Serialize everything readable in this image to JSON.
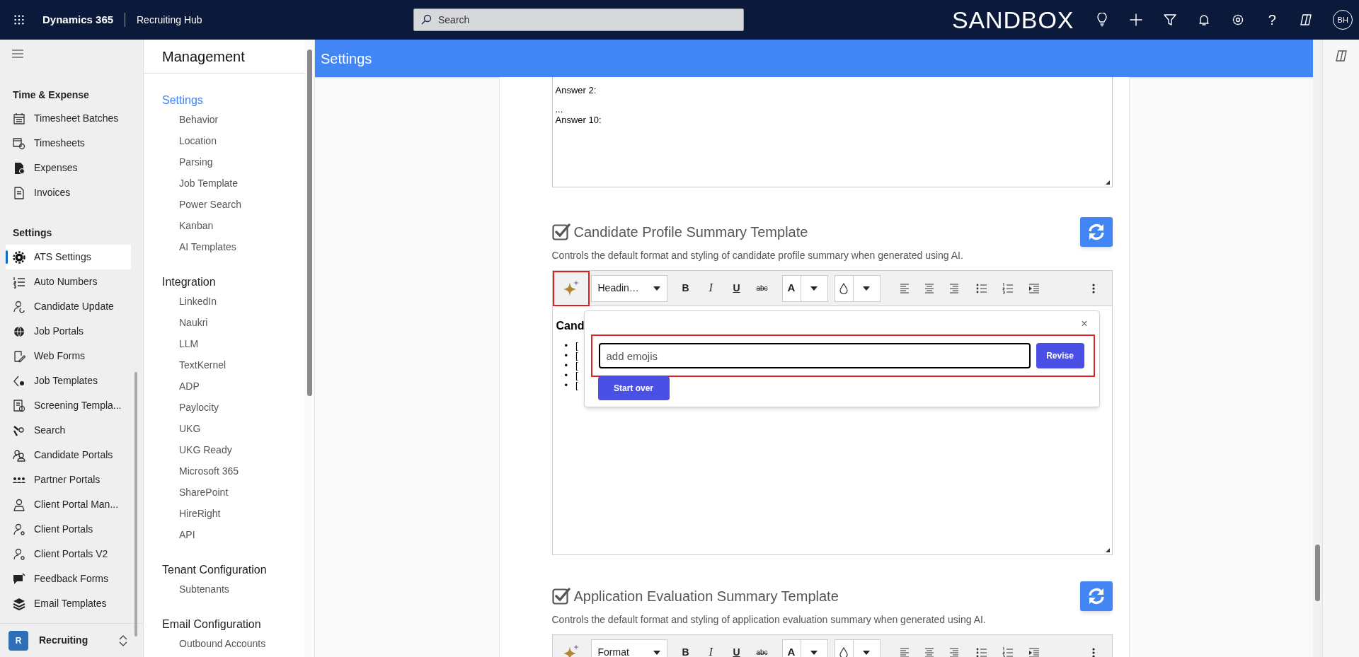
{
  "top_bar": {
    "app_name": "Dynamics 365",
    "area": "Recruiting Hub",
    "search": {
      "placeholder": "Search"
    },
    "environment": "SANDBOX",
    "help": "?",
    "avatar": "BH"
  },
  "nav": {
    "sections": [
      {
        "title": "Time & Expense",
        "items": [
          {
            "label": "Timesheet Batches",
            "selected": false
          },
          {
            "label": "Timesheets",
            "selected": false
          },
          {
            "label": "Expenses",
            "selected": false
          },
          {
            "label": "Invoices",
            "selected": false
          }
        ]
      },
      {
        "title": "Settings",
        "items": [
          {
            "label": "ATS Settings",
            "selected": true
          },
          {
            "label": "Auto Numbers",
            "selected": false
          },
          {
            "label": "Candidate Update",
            "selected": false
          },
          {
            "label": "Job Portals",
            "selected": false
          },
          {
            "label": "Web Forms",
            "selected": false
          },
          {
            "label": "Job Templates",
            "selected": false
          },
          {
            "label": "Screening Templa...",
            "selected": false
          },
          {
            "label": "Search",
            "selected": false
          },
          {
            "label": "Candidate Portals",
            "selected": false
          },
          {
            "label": "Partner Portals",
            "selected": false
          },
          {
            "label": "Client Portal Man...",
            "selected": false
          },
          {
            "label": "Client Portals",
            "selected": false
          },
          {
            "label": "Client Portals V2",
            "selected": false
          },
          {
            "label": "Feedback Forms",
            "selected": false
          },
          {
            "label": "Email Templates",
            "selected": false
          }
        ]
      }
    ],
    "area_switcher": {
      "badge": "R",
      "label": "Recruiting"
    }
  },
  "management": {
    "title": "Management",
    "groups": [
      {
        "title": "Settings",
        "selected": true,
        "items": [
          "Behavior",
          "Location",
          "Parsing",
          "Job Template",
          "Power Search",
          "Kanban",
          "AI Templates"
        ]
      },
      {
        "title": "Integration",
        "selected": false,
        "items": [
          "LinkedIn",
          "Naukri",
          "LLM",
          "TextKernel",
          "ADP",
          "Paylocity",
          "UKG",
          "UKG Ready",
          "Microsoft 365",
          "SharePoint",
          "HireRight",
          "API"
        ]
      },
      {
        "title": "Tenant Configuration",
        "selected": false,
        "items": [
          "Subtenants"
        ]
      },
      {
        "title": "Email Configuration",
        "selected": false,
        "items": [
          "Outbound Accounts"
        ]
      }
    ]
  },
  "page_header": "Settings",
  "answers_box": {
    "lines": [
      "Answer 2:",
      "...",
      "Answer 10:"
    ]
  },
  "templates": [
    {
      "enabled": true,
      "title": "Candidate Profile Summary Template",
      "description": "Controls the default format and styling of candidate profile summary when generated using AI.",
      "ai_highlighted": true,
      "toolbar": {
        "style": "Headin…",
        "bold": "B",
        "italic": "I",
        "underline": "U",
        "strike": "abc",
        "font_color": "A"
      },
      "body": {
        "heading": "Cand",
        "bullets": [
          "•   [",
          "•   [",
          "•   [",
          "•   [",
          "•   ["
        ]
      },
      "ai_popup": {
        "close": "×",
        "highlighted": true,
        "value": "add emojis",
        "revise": "Revise",
        "start_over": "Start over"
      }
    },
    {
      "enabled": true,
      "title": "Application Evaluation Summary Template",
      "description": "Controls the default format and styling of application evaluation summary when generated using AI.",
      "ai_highlighted": false,
      "toolbar": {
        "style": "Format",
        "bold": "B",
        "italic": "I",
        "underline": "U",
        "strike": "abc",
        "font_color": "A"
      }
    }
  ]
}
